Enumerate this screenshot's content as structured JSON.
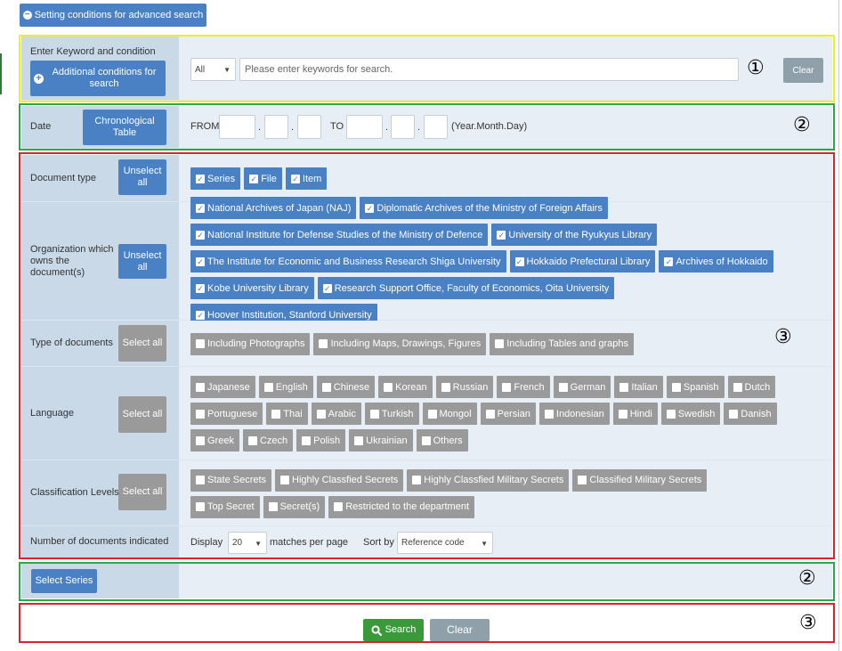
{
  "top_button": {
    "icon": "minus-circle-icon",
    "label": "Setting conditions for advanced search"
  },
  "keyword": {
    "label": "Enter Keyword and condition",
    "add_btn": "Additional conditions for search",
    "scope_value": "All",
    "placeholder": "Please enter keywords for search.",
    "clear": "Clear",
    "marker": "①"
  },
  "date": {
    "label": "Date",
    "chrono_btn": "Chronological Table",
    "from": "FROM",
    "to": "TO",
    "dot": ".",
    "hint": "(Year.Month.Day)",
    "marker": "②"
  },
  "doctype": {
    "label": "Document type",
    "btn": "Unselect all",
    "items": [
      "Series",
      "File",
      "Item"
    ]
  },
  "org": {
    "label": "Organization which owns the document(s)",
    "btn": "Unselect all",
    "items": [
      "National Archives of Japan (NAJ)",
      "Diplomatic Archives of the Ministry of Foreign Affairs",
      "National Institute for Defense Studies of the Ministry of Defence",
      "University of the Ryukyus Library",
      "The Institute for Economic and Business Research Shiga University",
      "Hokkaido Prefectural Library",
      "Archives of Hokkaido",
      "Kobe University Library",
      "Research Support Office, Faculty of Economics, Oita University",
      "Hoover Institution, Stanford University"
    ]
  },
  "types": {
    "label": "Type of documents",
    "btn": "Select all",
    "items": [
      "Including Photographs",
      "Including Maps, Drawings, Figures",
      "Including Tables and graphs"
    ],
    "marker": "③"
  },
  "language": {
    "label": "Language",
    "btn": "Select all",
    "items": [
      "Japanese",
      "English",
      "Chinese",
      "Korean",
      "Russian",
      "French",
      "German",
      "Italian",
      "Spanish",
      "Dutch",
      "Portuguese",
      "Thai",
      "Arabic",
      "Turkish",
      "Mongol",
      "Persian",
      "Indonesian",
      "Hindi",
      "Swedish",
      "Danish",
      "Greek",
      "Czech",
      "Polish",
      "Ukrainian",
      "Others"
    ]
  },
  "classification": {
    "label": "Classification Levels",
    "btn": "Select all",
    "items": [
      "State Secrets",
      "Highly Classfied Secrets",
      "Highly Classfied Military Secrets",
      "Classified Military Secrets",
      "Top Secret",
      "Secret(s)",
      "Restricted to the department"
    ]
  },
  "count": {
    "label": "Number of documents indicated",
    "display": "Display",
    "per_page_value": "20",
    "per_page_text": "matches per page",
    "sort_label": "Sort by",
    "sort_value": "Reference code"
  },
  "series": {
    "btn": "Select Series",
    "marker": "②"
  },
  "footer": {
    "search": "Search",
    "search_icon": "magnifier-icon",
    "clear": "Clear",
    "marker": "③"
  },
  "colors": {
    "accent": "#4a80c4",
    "gray_chip": "#9a9a9a",
    "label_bg": "#c9d9e8",
    "content_bg": "#e8eef5",
    "search_green": "#3a9a3a"
  }
}
